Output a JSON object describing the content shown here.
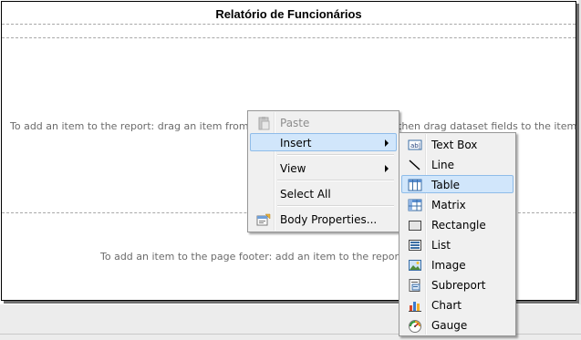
{
  "report": {
    "title": "Relatório de Funcionários",
    "body_hint": "To add an item to the report: drag an item from the Toolbox to the design surface, and then drag dataset fields to the item.",
    "body_hint_left": "To add an item to the report: drag an item from the To",
    "body_hint_right": "then drag dataset fields to the item.",
    "footer_hint_visible": "To add an item to the page footer: add an item to the report and t"
  },
  "context_menu": {
    "items": [
      {
        "label": "Paste",
        "icon": "paste-icon",
        "disabled": true
      },
      {
        "label": "Insert",
        "icon": "",
        "submenu": true,
        "highlighted": true
      },
      {
        "label": "View",
        "icon": "",
        "submenu": true
      },
      {
        "label": "Select All",
        "icon": ""
      },
      {
        "label": "Body Properties...",
        "icon": "properties-icon"
      }
    ]
  },
  "insert_submenu": {
    "items": [
      {
        "label": "Text Box",
        "icon": "textbox-icon"
      },
      {
        "label": "Line",
        "icon": "line-icon"
      },
      {
        "label": "Table",
        "icon": "table-icon",
        "highlighted": true
      },
      {
        "label": "Matrix",
        "icon": "matrix-icon"
      },
      {
        "label": "Rectangle",
        "icon": "rectangle-icon"
      },
      {
        "label": "List",
        "icon": "list-icon"
      },
      {
        "label": "Image",
        "icon": "image-icon"
      },
      {
        "label": "Subreport",
        "icon": "subreport-icon"
      },
      {
        "label": "Chart",
        "icon": "chart-icon"
      },
      {
        "label": "Gauge",
        "icon": "gauge-icon"
      }
    ]
  },
  "colors": {
    "highlight_bg": "#d1e6fb",
    "highlight_border": "#8fbce9",
    "menu_bg": "#f0f0f0",
    "hint_text": "#6b6b6b"
  }
}
